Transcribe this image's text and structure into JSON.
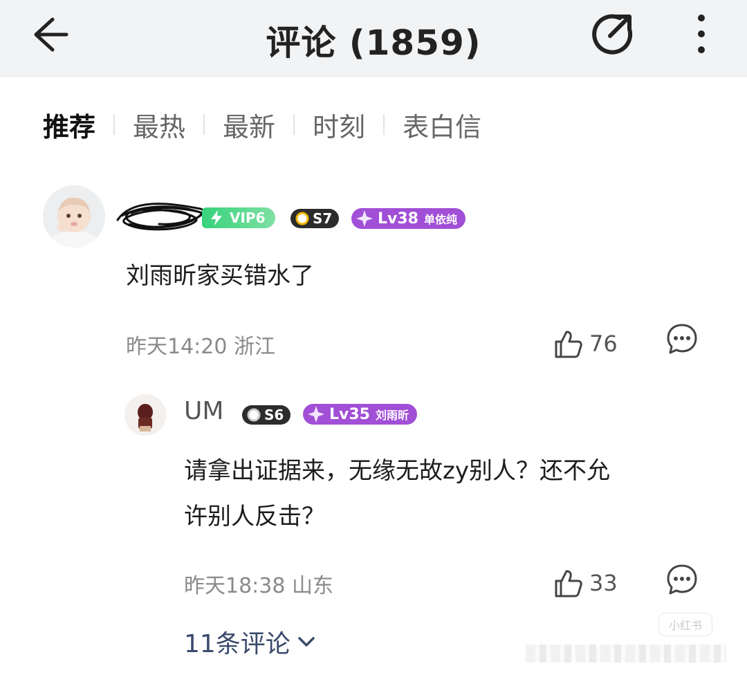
{
  "header": {
    "title": "评论 (1859)",
    "back_icon": "arrow-left-icon",
    "share_icon": "share-icon",
    "more_icon": "more-vertical-icon"
  },
  "tabs": [
    {
      "label": "推荐",
      "active": true
    },
    {
      "label": "最热",
      "active": false
    },
    {
      "label": "最新",
      "active": false
    },
    {
      "label": "时刻",
      "active": false
    },
    {
      "label": "表白信",
      "active": false
    }
  ],
  "comment": {
    "badges": {
      "vip": "VIP6",
      "season": "S7",
      "level": "Lv38",
      "level_name": "单依纯"
    },
    "text": "刘雨昕家买错水了",
    "time_location": "昨天14:20 浙江",
    "likes": "76"
  },
  "reply": {
    "username": "UM",
    "badges": {
      "season": "S6",
      "level": "Lv35",
      "level_name": "刘雨昕"
    },
    "text_line1": "请拿出证据来，无缘无故zy别人？还不允",
    "text_line2": "许别人反击？",
    "time_location": "昨天18:38 山东",
    "likes": "33"
  },
  "more_replies": "11条评论",
  "watermark": "小红书",
  "colors": {
    "header_bg": "#f2f3f5",
    "vip_green": "#37d27c",
    "level_purple": "#a14fd6",
    "link_blue": "#3b4a6b"
  }
}
